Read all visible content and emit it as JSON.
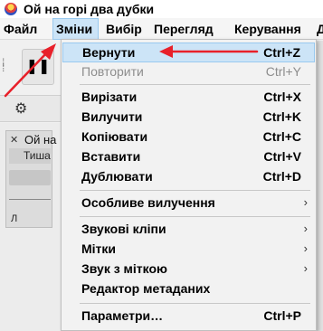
{
  "window": {
    "title": "Ой на горі два дубки"
  },
  "menubar": {
    "items": [
      {
        "label": "Файл"
      },
      {
        "label": "Зміни"
      },
      {
        "label": "Вибір"
      },
      {
        "label": "Перегляд"
      },
      {
        "label": "Керування"
      },
      {
        "label": "Д"
      }
    ]
  },
  "edit_menu": {
    "items": [
      {
        "label": "Вернути",
        "shortcut": "Ctrl+Z"
      },
      {
        "label": "Повторити",
        "shortcut": "Ctrl+Y"
      },
      {
        "label": "Вирізати",
        "shortcut": "Ctrl+X"
      },
      {
        "label": "Вилучити",
        "shortcut": "Ctrl+K"
      },
      {
        "label": "Копіювати",
        "shortcut": "Ctrl+C"
      },
      {
        "label": "Вставити",
        "shortcut": "Ctrl+V"
      },
      {
        "label": "Дублювати",
        "shortcut": "Ctrl+D"
      },
      {
        "label": "Особливе вилучення"
      },
      {
        "label": "Звукові кліпи"
      },
      {
        "label": "Мітки"
      },
      {
        "label": "Звук з міткою"
      },
      {
        "label": "Редактор метаданих"
      },
      {
        "label": "Параметри…",
        "shortcut": "Ctrl+P"
      }
    ]
  },
  "track": {
    "name": "Ой на",
    "sub_label": "Тиша",
    "letter": "Л"
  },
  "icons": {
    "pause": "pause-icon",
    "settings": "gear-icon",
    "submenu": "chevron-right-icon"
  },
  "colors": {
    "highlight": "#cce4f7",
    "highlight_border": "#99c9ef",
    "annotation": "#e8202a"
  }
}
